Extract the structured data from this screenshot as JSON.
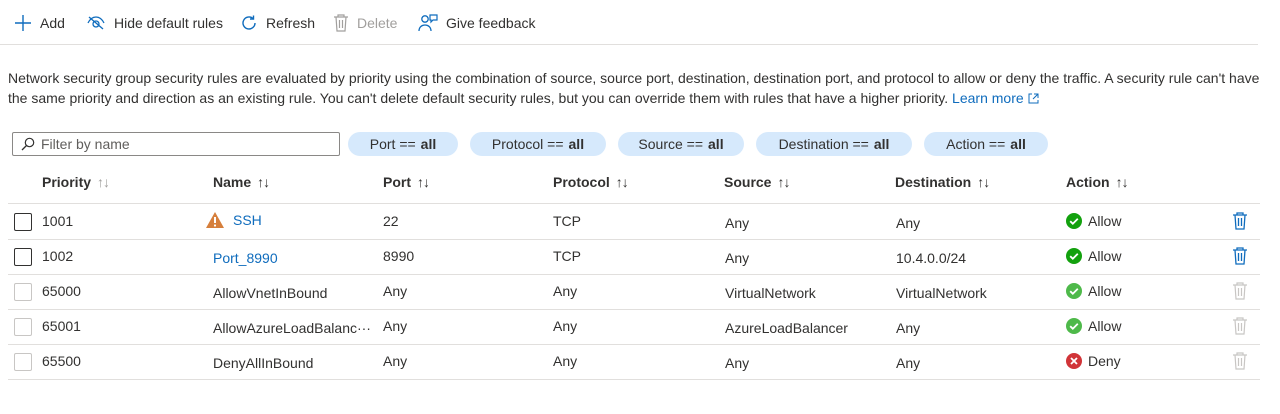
{
  "toolbar": {
    "add_label": "Add",
    "hide_default_label": "Hide default rules",
    "refresh_label": "Refresh",
    "delete_label": "Delete",
    "feedback_label": "Give feedback"
  },
  "description": {
    "text": "Network security group security rules are evaluated by priority using the combination of source, source port, destination, destination port, and protocol to allow or deny the traffic. A security rule can't have the same priority and direction as an existing rule. You can't delete default security rules, but you can override them with rules that have a higher priority.",
    "learn_more": "Learn more"
  },
  "filter": {
    "placeholder": "Filter by name"
  },
  "pills": [
    {
      "key": "Port ==",
      "value": "all"
    },
    {
      "key": "Protocol ==",
      "value": "all"
    },
    {
      "key": "Source ==",
      "value": "all"
    },
    {
      "key": "Destination ==",
      "value": "all"
    },
    {
      "key": "Action ==",
      "value": "all"
    }
  ],
  "columns": [
    "Priority",
    "Name",
    "Port",
    "Protocol",
    "Source",
    "Destination",
    "Action"
  ],
  "sort_arrows": "↑↓",
  "rows": [
    {
      "priority": "1001",
      "name": "SSH",
      "port": "22",
      "protocol": "TCP",
      "source": "Any",
      "destination": "Any",
      "action": "Allow"
    },
    {
      "priority": "1002",
      "name": "Port_8990",
      "port": "8990",
      "protocol": "TCP",
      "source": "Any",
      "destination": "10.4.0.0/24",
      "action": "Allow"
    },
    {
      "priority": "65000",
      "name": "AllowVnetInBound",
      "port": "Any",
      "protocol": "Any",
      "source": "VirtualNetwork",
      "destination": "VirtualNetwork",
      "action": "Allow"
    },
    {
      "priority": "65001",
      "name": "AllowAzureLoadBalanc···",
      "port": "Any",
      "protocol": "Any",
      "source": "AzureLoadBalancer",
      "destination": "Any",
      "action": "Allow"
    },
    {
      "priority": "65500",
      "name": "DenyAllInBound",
      "port": "Any",
      "protocol": "Any",
      "source": "Any",
      "destination": "Any",
      "action": "Deny"
    }
  ],
  "colors": {
    "link": "#0f6cbd",
    "pill_bg": "#d6e9fc",
    "allow": "#13a10e",
    "deny": "#d13438",
    "warning": "#d67f3c",
    "disabled": "#a19f9d"
  }
}
